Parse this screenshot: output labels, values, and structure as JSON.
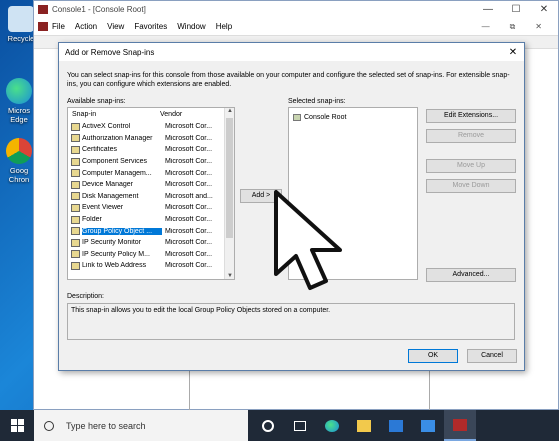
{
  "desktop": {
    "icons": [
      {
        "label": "Recycle",
        "name": "recycle-bin"
      },
      {
        "label": "Micros Edge",
        "name": "edge"
      },
      {
        "label": "Goog Chron",
        "name": "chrome"
      }
    ]
  },
  "mmc": {
    "title": "Console1 - [Console Root]",
    "menu": [
      "File",
      "Action",
      "View",
      "Favorites",
      "Window",
      "Help"
    ]
  },
  "dialog": {
    "title": "Add or Remove Snap-ins",
    "description": "You can select snap-ins for this console from those available on your computer and configure the selected set of snap-ins. For extensible snap-ins, you can configure which extensions are enabled.",
    "available_label": "Available snap-ins:",
    "selected_label": "Selected snap-ins:",
    "columns": {
      "snapin": "Snap-in",
      "vendor": "Vendor"
    },
    "snapins": [
      {
        "name": "ActiveX Control",
        "vendor": "Microsoft Cor..."
      },
      {
        "name": "Authorization Manager",
        "vendor": "Microsoft Cor..."
      },
      {
        "name": "Certificates",
        "vendor": "Microsoft Cor..."
      },
      {
        "name": "Component Services",
        "vendor": "Microsoft Cor..."
      },
      {
        "name": "Computer Managem...",
        "vendor": "Microsoft Cor..."
      },
      {
        "name": "Device Manager",
        "vendor": "Microsoft Cor..."
      },
      {
        "name": "Disk Management",
        "vendor": "Microsoft and..."
      },
      {
        "name": "Event Viewer",
        "vendor": "Microsoft Cor..."
      },
      {
        "name": "Folder",
        "vendor": "Microsoft Cor..."
      },
      {
        "name": "Group Policy Object ...",
        "vendor": "Microsoft Cor..."
      },
      {
        "name": "IP Security Monitor",
        "vendor": "Microsoft Cor..."
      },
      {
        "name": "IP Security Policy M...",
        "vendor": "Microsoft Cor..."
      },
      {
        "name": "Link to Web Address",
        "vendor": "Microsoft Cor..."
      }
    ],
    "selected_index": 9,
    "selected_snapins": [
      "Console Root"
    ],
    "buttons": {
      "add": "Add >",
      "edit_extensions": "Edit Extensions...",
      "remove": "Remove",
      "move_up": "Move Up",
      "move_down": "Move Down",
      "advanced": "Advanced...",
      "ok": "OK",
      "cancel": "Cancel"
    },
    "description_label": "Description:",
    "description_text": "This snap-in allows you to edit the local Group Policy Objects stored on a computer."
  },
  "taskbar": {
    "search_placeholder": "Type here to search"
  }
}
